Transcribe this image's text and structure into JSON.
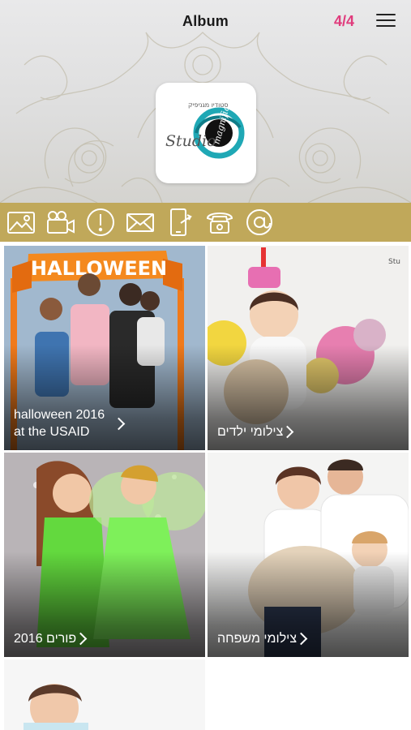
{
  "header": {
    "title": "Album",
    "counter": "4/4",
    "logo": {
      "brand": "Studio",
      "script": "magnifique"
    }
  },
  "iconbar": {
    "icons": [
      "gallery-icon",
      "video-icon",
      "info-icon",
      "mail-icon",
      "share-icon",
      "phone-icon",
      "at-icon"
    ]
  },
  "albums": [
    {
      "title_line1": "halloween 2016",
      "title_line2": "at the USAID",
      "banner": "HALLOWEEN"
    },
    {
      "title": "צילומי ילדים"
    },
    {
      "title": "פורים 2016"
    },
    {
      "title": "צילומי משפחה"
    },
    {
      "title": ""
    }
  ],
  "colors": {
    "accent": "#e03b7c",
    "iconbar": "#c0a85a"
  }
}
